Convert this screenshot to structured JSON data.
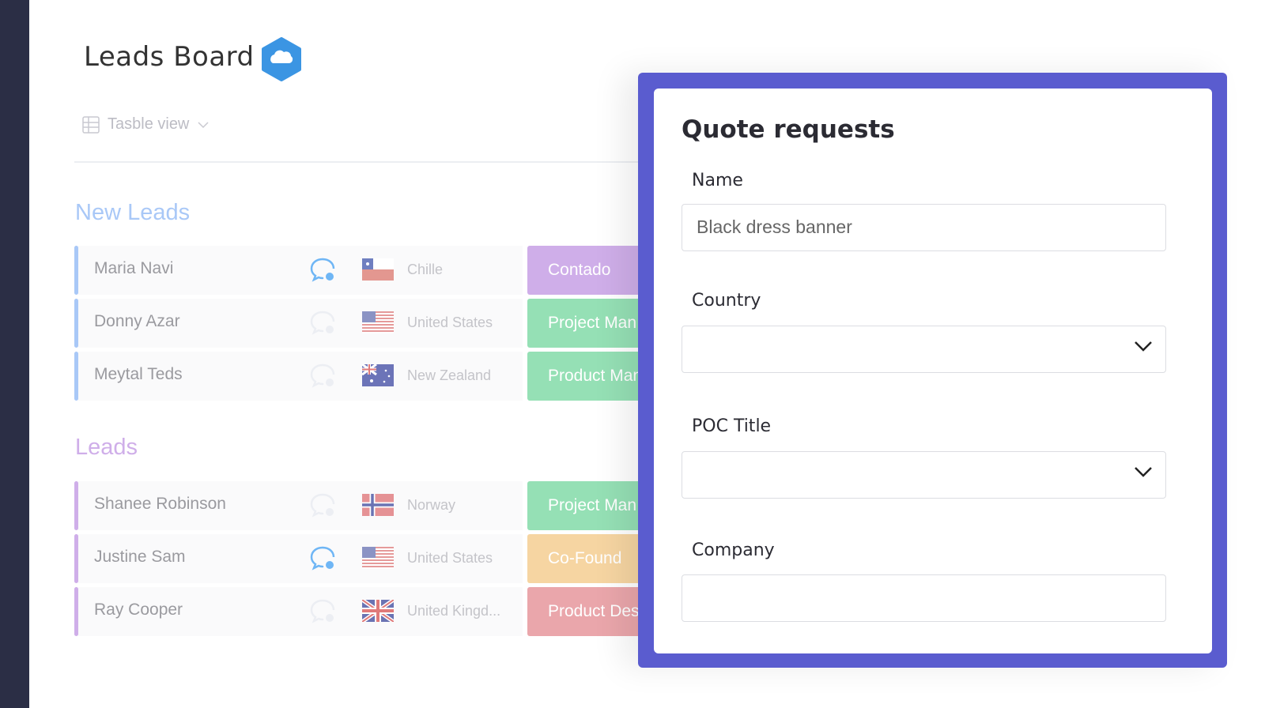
{
  "board": {
    "title": "Leads Board",
    "view_label": "Tasble view",
    "groups": [
      {
        "title": "New Leads",
        "color": "#a9c8f7",
        "rows": [
          {
            "name": "Maria Navi",
            "chat_active": true,
            "country": "Chille",
            "flag": "chile",
            "status": "Contado",
            "status_color": "#cfaee9"
          },
          {
            "name": "Donny Azar",
            "chat_active": false,
            "country": "United States",
            "flag": "us",
            "status": "Project Man",
            "status_color": "#95e0b5"
          },
          {
            "name": "Meytal Teds",
            "chat_active": false,
            "country": "New Zealand",
            "flag": "nz",
            "status": "Product Man",
            "status_color": "#95e0b5"
          }
        ]
      },
      {
        "title": "Leads",
        "color": "#cfaee9",
        "rows": [
          {
            "name": "Shanee Robinson",
            "chat_active": false,
            "country": "Norway",
            "flag": "norway",
            "status": "Project Man",
            "status_color": "#95e0b5"
          },
          {
            "name": "Justine Sam",
            "chat_active": true,
            "country": "United States",
            "flag": "us",
            "status": "Co-Found",
            "status_color": "#f6d5a2"
          },
          {
            "name": "Ray Cooper",
            "chat_active": false,
            "country": "United Kingd...",
            "flag": "uk",
            "status": "Product Des",
            "status_color": "#eaa6ab"
          }
        ]
      }
    ]
  },
  "form": {
    "title": "Quote requests",
    "accent": "#5a5ccf",
    "name_label": "Name",
    "name_value": "Black dress banner",
    "country_label": "Country",
    "country_value": "",
    "poc_label": "POC Title",
    "poc_value": "",
    "company_label": "Company",
    "company_value": ""
  }
}
